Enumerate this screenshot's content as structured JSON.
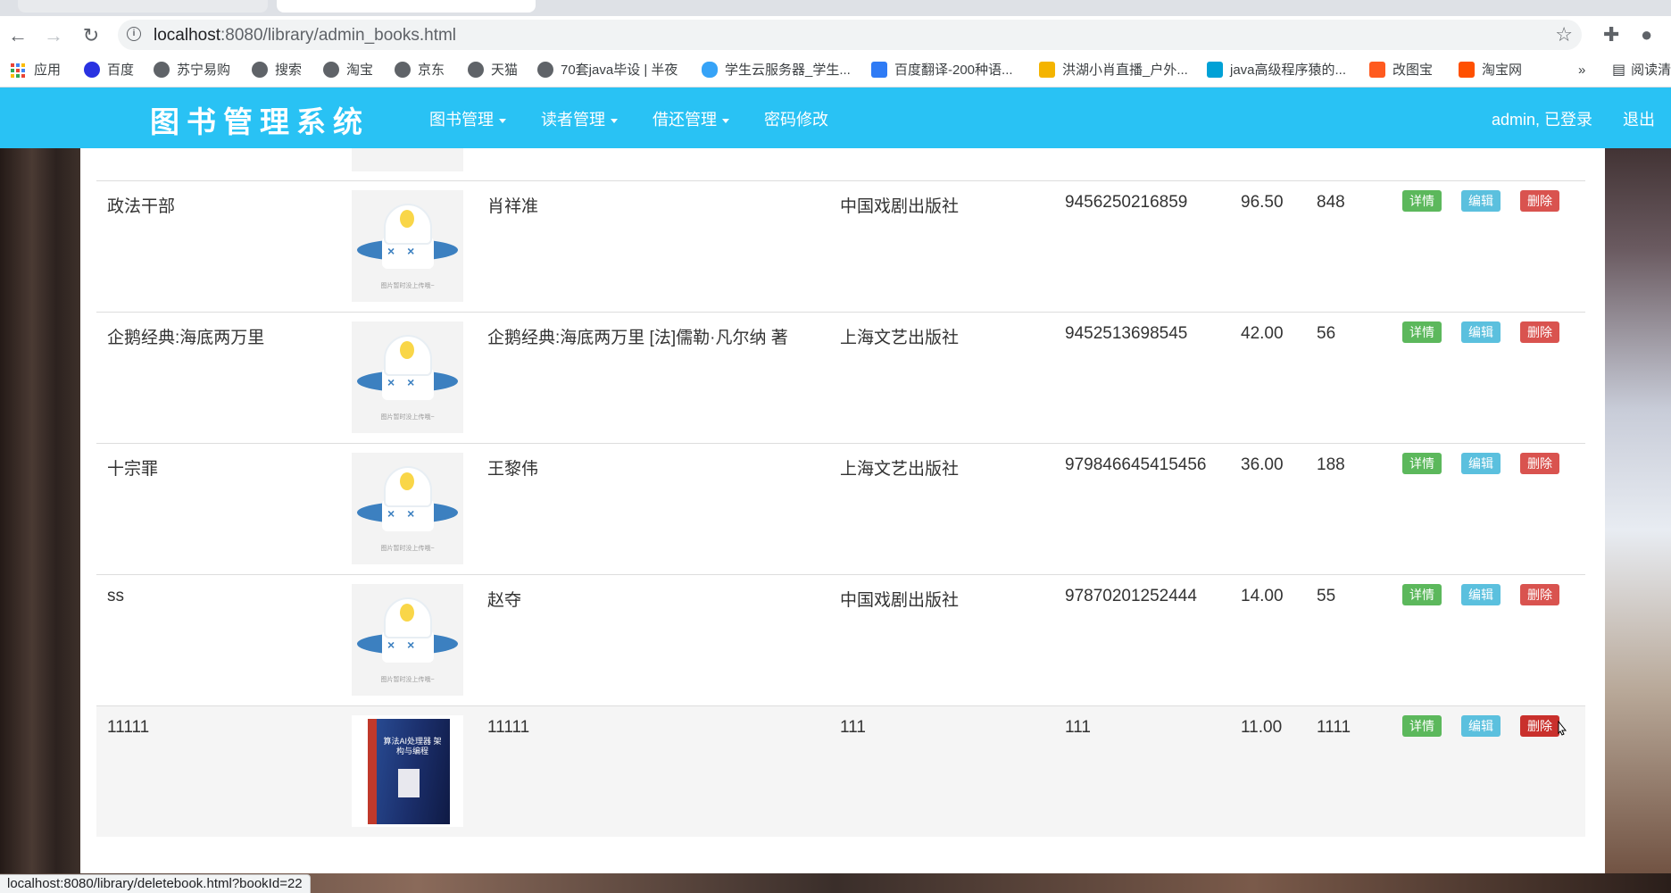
{
  "browser": {
    "url_host": "localhost",
    "url_rest": ":8080/library/admin_books.html",
    "status_url": "localhost:8080/library/deletebook.html?bookId=22",
    "bookmarks": [
      {
        "label": "应用",
        "icon": "apps-grid-icon"
      },
      {
        "label": "百度",
        "icon": "baidu-paw-icon"
      },
      {
        "label": "苏宁易购",
        "icon": "globe-icon"
      },
      {
        "label": "搜索",
        "icon": "globe-icon"
      },
      {
        "label": "淘宝",
        "icon": "globe-icon"
      },
      {
        "label": "京东",
        "icon": "globe-icon"
      },
      {
        "label": "天猫",
        "icon": "globe-icon"
      },
      {
        "label": "70套java毕设 | 半夜",
        "icon": "globe-icon"
      },
      {
        "label": "学生云服务器_学生...",
        "icon": "cloud-icon"
      },
      {
        "label": "百度翻译-200种语...",
        "icon": "translate-icon"
      },
      {
        "label": "洪湖小肖直播_户外...",
        "icon": "bilibili-icon"
      },
      {
        "label": "java高级程序猿的...",
        "icon": "bilibili-icon"
      },
      {
        "label": "改图宝",
        "icon": "gaitubao-icon"
      },
      {
        "label": "淘宝网",
        "icon": "taobao-icon"
      }
    ],
    "more": "»",
    "reading_list": "阅读清"
  },
  "navbar": {
    "brand": "图书管理系统",
    "menu": [
      "图书管理",
      "读者管理",
      "借还管理",
      "密码修改"
    ],
    "user": "admin, 已登录",
    "logout": "退出"
  },
  "table": {
    "caption_placeholder": "图片暂时没上传哦~",
    "actions": {
      "detail": "详情",
      "edit": "编辑",
      "delete": "删除"
    },
    "rows": [
      {
        "name": "政法干部",
        "author": "肖祥准",
        "publisher": "中国戏剧出版社",
        "isbn": "9456250216859",
        "price": "96.50",
        "number": "848",
        "cover": "placeholder"
      },
      {
        "name": "企鹅经典:海底两万里",
        "author": "企鹅经典:海底两万里 [法]儒勒·凡尔纳 著",
        "publisher": "上海文艺出版社",
        "isbn": "9452513698545",
        "price": "42.00",
        "number": "56",
        "cover": "placeholder"
      },
      {
        "name": "十宗罪",
        "author": "王黎伟",
        "publisher": "上海文艺出版社",
        "isbn": "979846645415456",
        "price": "36.00",
        "number": "188",
        "cover": "placeholder"
      },
      {
        "name": "ss",
        "author": "赵夺",
        "publisher": "中国戏剧出版社",
        "isbn": "97870201252444",
        "price": "14.00",
        "number": "55",
        "cover": "placeholder"
      },
      {
        "name": "11111",
        "author": "11111",
        "publisher": "111",
        "isbn": "111",
        "price": "11.00",
        "number": "1111",
        "cover": "book",
        "hover": true
      }
    ]
  },
  "book_cover_title": "算法AI处理器 架构与编程"
}
